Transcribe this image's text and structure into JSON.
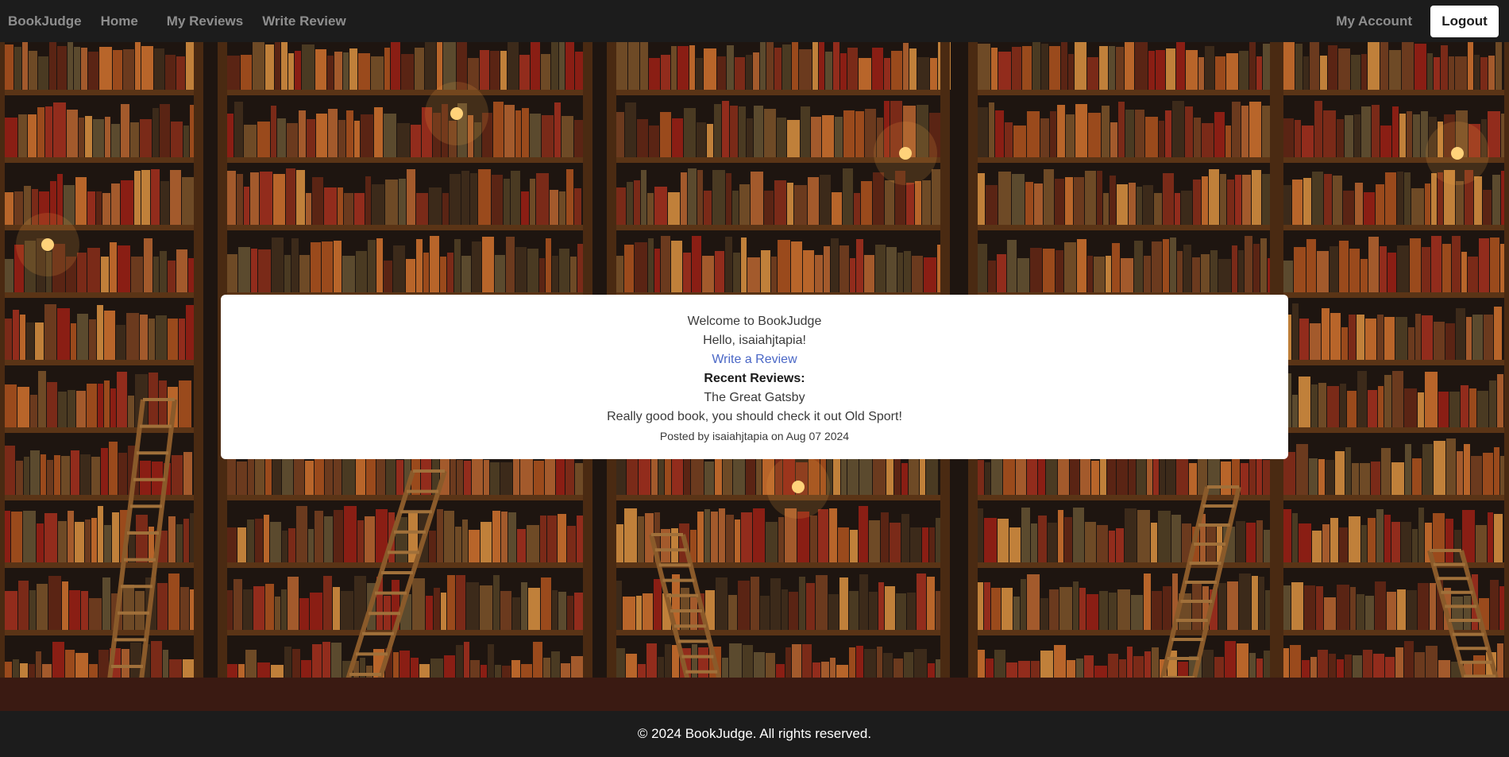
{
  "nav": {
    "brand": "BookJudge",
    "home": "Home",
    "my_reviews": "My Reviews",
    "write_review": "Write Review",
    "my_account": "My Account",
    "logout": "Logout"
  },
  "welcome": {
    "title": "Welcome to BookJudge",
    "greeting": "Hello, isaiahjtapia!",
    "write_link": "Write a Review",
    "recent_heading": "Recent Reviews:",
    "review": {
      "book_title": "The Great Gatsby",
      "text": "Really good book, you should check it out Old Sport!",
      "meta": "Posted by isaiahjtapia on Aug 07 2024"
    }
  },
  "footer": {
    "text": "© 2024 BookJudge. All rights reserved."
  },
  "colors": {
    "navbar_bg": "#1c1c1c",
    "nav_text": "#8e8e8e",
    "link": "#4a67c6",
    "card_bg": "#ffffff"
  }
}
